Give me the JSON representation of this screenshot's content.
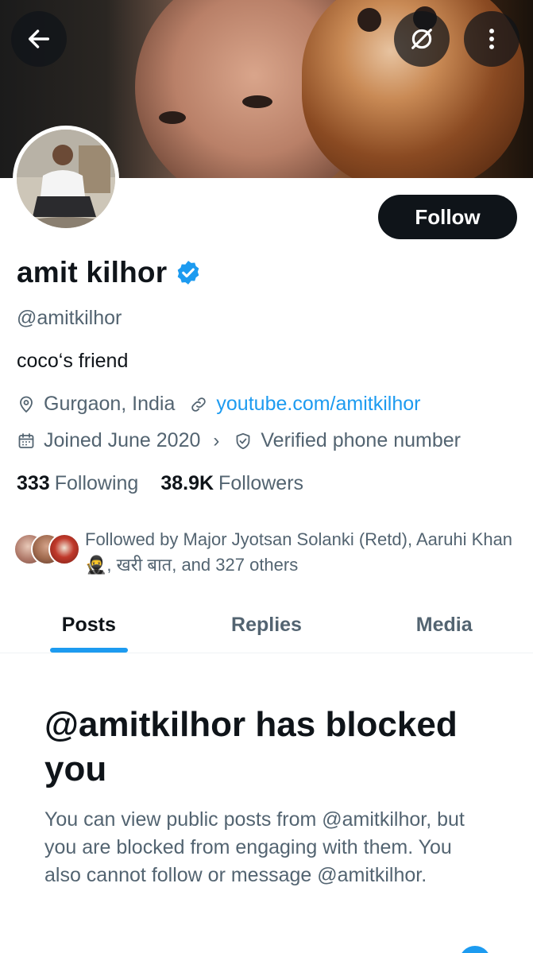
{
  "banner": {
    "back_icon": "arrow-left-icon",
    "grok_icon": "slash-circle-icon",
    "more_icon": "more-vertical-icon"
  },
  "profile": {
    "display_name": "amit kilhor",
    "handle": "@amitkilhor",
    "bio": "coco‘s friend",
    "location": "Gurgaon, India",
    "website": "youtube.com/amitkilhor",
    "joined": "Joined June 2020",
    "verified_phone": "Verified phone number",
    "follow_label": "Follow"
  },
  "stats": {
    "following_count": "333",
    "following_label": "Following",
    "followers_count": "38.9K",
    "followers_label": "Followers"
  },
  "followed_by": {
    "text": "Followed by Major Jyotsan Solanki (Retd), Aaruhi Khan🥷, खरी बात, and 327 others"
  },
  "tabs": [
    {
      "label": "Posts",
      "active": true
    },
    {
      "label": "Replies",
      "active": false
    },
    {
      "label": "Media",
      "active": false
    }
  ],
  "blocked": {
    "title": "@amitkilhor has blocked you",
    "description": "You can view public posts from @amitkilhor, but you are blocked from engaging with them. You also cannot follow or message @amitkilhor."
  },
  "colors": {
    "accent": "#1d9bf0",
    "text_primary": "#0f1419",
    "text_secondary": "#536471",
    "follow_bg": "#0f1419"
  }
}
